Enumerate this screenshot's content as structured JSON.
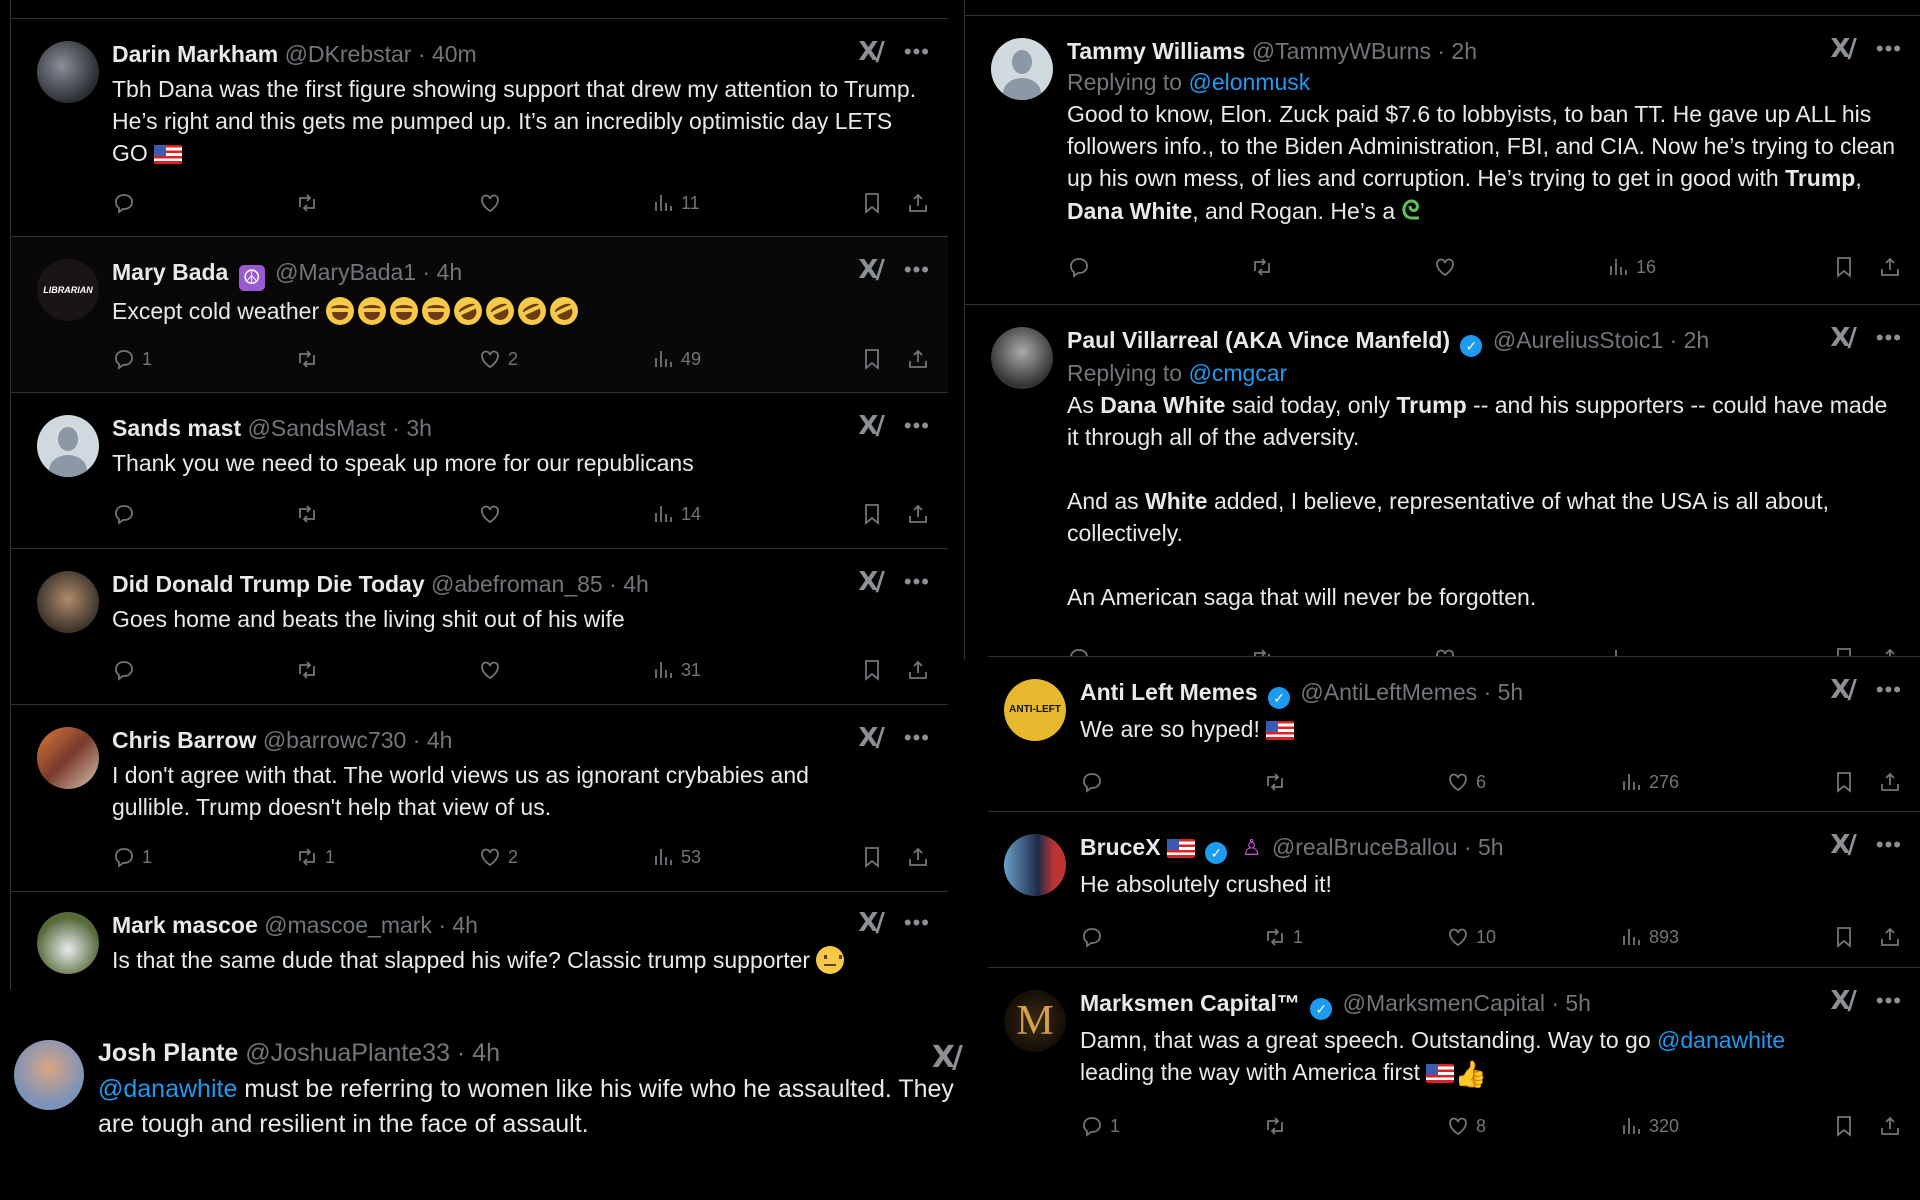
{
  "left_column": [
    {
      "name": "Darin Markham",
      "handle": "@DKrebstar",
      "time": "40m",
      "text": "Tbh Dana was the first figure showing support that drew my attention to Trump. He’s right and this gets me pumped up. It’s an incredibly optimistic day LETS GO",
      "emoji": "flag-us",
      "replies": "",
      "reposts": "",
      "likes": "",
      "views": "11"
    },
    {
      "name": "Mary Bada",
      "badge": "peace-symbol",
      "handle": "@MaryBada1",
      "time": "4h",
      "text": "Except cold weather",
      "emoji": "4x joy, 4x rofl",
      "replies": "1",
      "reposts": "",
      "likes": "2",
      "views": "49",
      "avatar_label": "LIBRARIAN"
    },
    {
      "name": "Sands mast",
      "handle": "@SandsMast",
      "time": "3h",
      "text": "Thank you we need to speak up more for our republicans",
      "replies": "",
      "reposts": "",
      "likes": "",
      "views": "14"
    },
    {
      "name": "Did Donald Trump Die Today",
      "handle": "@abefroman_85",
      "time": "4h",
      "text": "Goes home and beats the living shit out of his wife",
      "replies": "",
      "reposts": "",
      "likes": "",
      "views": "31"
    },
    {
      "name": "Chris Barrow",
      "handle": "@barrowc730",
      "time": "4h",
      "text": "I don't agree with that. The world views us as ignorant crybabies and gullible. Trump doesn't help that view of us.",
      "replies": "1",
      "reposts": "1",
      "likes": "2",
      "views": "53"
    },
    {
      "name": "Mark mascoe",
      "handle": "@mascoe_mark",
      "time": "4h",
      "text": "Is that the same dude that slapped his wife? Classic trump supporter",
      "emoji": "neutral-face"
    }
  ],
  "josh": {
    "name": "Josh Plante",
    "handle": "@JoshuaPlante33",
    "time": "4h",
    "mention": "@danawhite",
    "text": " must be referring to women like his wife who he assaulted. They are tough and resilient in the face of assault."
  },
  "right_column": [
    {
      "name": "Tammy Williams",
      "handle": "@TammyWBurns",
      "time": "2h",
      "replying_label": "Replying to",
      "replying_to": "@elonmusk",
      "text_parts": [
        "Good to know, Elon. Zuck paid $7.6 to lobbyists, to ban TT. He gave up ALL his followers info., to the Biden Administration, FBI, and CIA. Now he’s trying to clean up his own mess, of lies and corruption. He’s trying to get in good with ",
        "Trump",
        ", ",
        "Dana White",
        ", and Rogan. He’s a "
      ],
      "emoji": "snake",
      "replies": "",
      "reposts": "",
      "likes": "",
      "views": "16"
    },
    {
      "name": "Paul Villarreal (AKA Vince Manfeld)",
      "verified": true,
      "handle": "@AureliusStoic1",
      "time": "2h",
      "replying_label": "Replying to",
      "replying_to": "@cmgcar",
      "p1": [
        "As ",
        "Dana White",
        " said today, only ",
        "Trump",
        " -- and his supporters -- could have made it through all of the adversity."
      ],
      "p2": [
        "And as ",
        "White",
        " added, I believe, representative of what the USA is all about, collectively."
      ],
      "p3": "An American saga that will never be forgotten."
    },
    {
      "name": "Anti Left Memes",
      "verified": true,
      "handle": "@AntiLeftMemes",
      "time": "5h",
      "text": "We are so hyped!",
      "emoji": "flag-us",
      "replies": "",
      "reposts": "",
      "likes": "6",
      "views": "276",
      "avatar_label": "ANTI-LEFT MEMES"
    },
    {
      "name": "BruceX",
      "verified": true,
      "handle": "@realBruceBallou",
      "time": "5h",
      "text": "He absolutely crushed it!",
      "replies": "",
      "reposts": "1",
      "likes": "10",
      "views": "893"
    },
    {
      "name": "Marksmen Capital™",
      "verified": true,
      "handle": "@MarksmenCapital",
      "time": "5h",
      "text_before": "Damn, that was a great speech. Outstanding. Way to go ",
      "mention": "@danawhite",
      "text_after": " leading the way with America first",
      "emoji": "flag-us, thumbs-up",
      "replies": "1",
      "reposts": "",
      "likes": "8",
      "views": "320",
      "avatar_label": "M"
    }
  ],
  "common": {
    "dot": "·",
    "more": "•••",
    "grok": "X/",
    "verified_mark": "✓",
    "peace": "☮",
    "person_star": "♙",
    "snake": "ᘓ",
    "thumb": "👍"
  },
  "colors": {
    "background": "#000000",
    "text": "#e7e9ea",
    "muted": "#71767b",
    "link": "#1d9bf0",
    "divider": "#2f3336"
  }
}
